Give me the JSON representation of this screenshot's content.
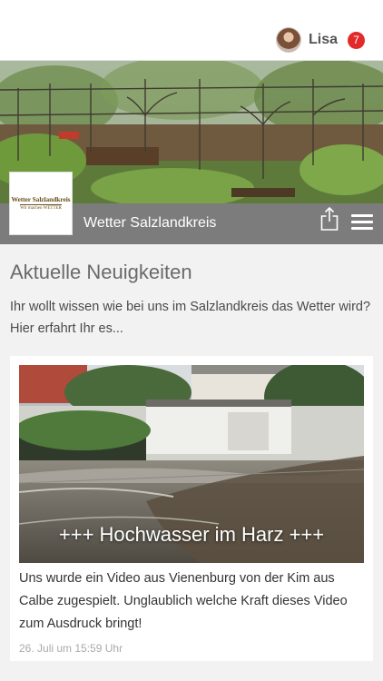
{
  "header": {
    "user_name": "Lisa",
    "notification_count": "7"
  },
  "hero": {
    "logo_text": "Wetter Salzlandkreis",
    "logo_subtext": "Wir machen WETTER",
    "site_title": "Wetter Salzlandkreis"
  },
  "main": {
    "section_title": "Aktuelle Neuigkeiten",
    "intro": "Ihr wollt wissen wie bei uns im Salzlandkreis das Wetter wird? Hier erfahrt Ihr es..."
  },
  "post": {
    "headline": "+++ Hochwasser im Harz +++",
    "text": "Uns wurde ein Video aus Vienenburg von der Kim aus Calbe zugespielt. Unglaublich welche Kraft dieses Video zum Ausdruck bringt!",
    "date": "26. Juli um 15:59 Uhr"
  },
  "icons": {
    "avatar": "avatar",
    "share": "share-icon",
    "menu": "menu-icon"
  },
  "colors": {
    "badge": "#e22a2a",
    "hero_bar": "#7c7c7c"
  }
}
